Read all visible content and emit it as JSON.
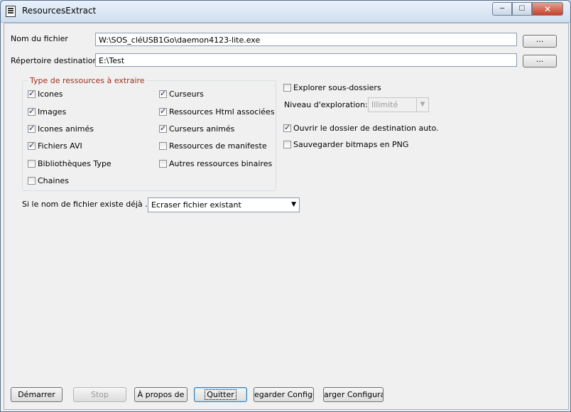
{
  "window": {
    "title": "ResourcesExtract",
    "min_glyph": "─",
    "max_glyph": "☐",
    "close_glyph": "✕"
  },
  "filename": {
    "label": "Nom du fichier",
    "value": "W:\\SOS_cléUSB1Go\\daemon4123-lite.exe",
    "browse_label": "..."
  },
  "destination": {
    "label": "Répertoire destination",
    "value": "E:\\Test",
    "browse_label": "..."
  },
  "resource_types": {
    "legend": "Type de ressources à extraire",
    "items": [
      {
        "label": "Icones",
        "checked": true
      },
      {
        "label": "Curseurs",
        "checked": true
      },
      {
        "label": "Images",
        "checked": true
      },
      {
        "label": "Ressources Html associées",
        "checked": true
      },
      {
        "label": "Icones animés",
        "checked": true
      },
      {
        "label": "Curseurs animés",
        "checked": true
      },
      {
        "label": "Fichiers AVI",
        "checked": true
      },
      {
        "label": "Ressources de manifeste",
        "checked": false
      },
      {
        "label": "Bibliothèques Type",
        "checked": false
      },
      {
        "label": "Autres ressources binaires",
        "checked": false
      },
      {
        "label": "Chaines",
        "checked": false
      }
    ]
  },
  "options": {
    "explore_subfolders": {
      "label": "Explorer sous-dossiers",
      "checked": false
    },
    "exploration_level": {
      "label": "Niveau d'exploration:",
      "value": "Illimité"
    },
    "open_dest_folder": {
      "label": "Ouvrir le dossier de destination auto.",
      "checked": true
    },
    "save_png": {
      "label": "Sauvegarder bitmaps en PNG",
      "checked": false
    }
  },
  "exists": {
    "label": "Si le nom de fichier existe déjà ...",
    "value": "Ecraser fichier existant"
  },
  "buttons": {
    "start": "Démarrer",
    "stop": "Stop",
    "about": "À propos de",
    "quit": "Quitter",
    "save_config": "egarder Configur",
    "load_config": "arger Configurati"
  },
  "icons": {
    "dropdown": "▼",
    "check": "✓"
  }
}
